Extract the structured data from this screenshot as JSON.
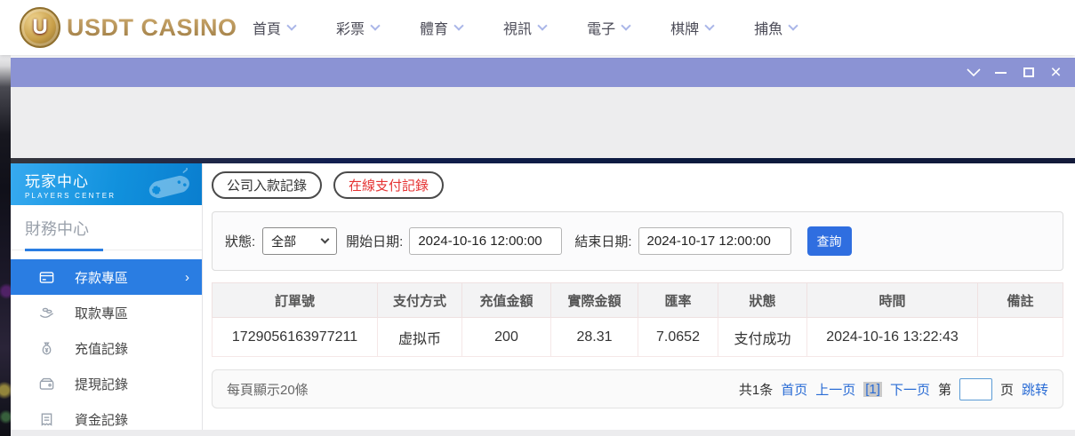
{
  "header": {
    "logo_text": "USDT CASINO",
    "logo_letter": "U",
    "nav": [
      {
        "label": "首頁"
      },
      {
        "label": "彩票"
      },
      {
        "label": "體育"
      },
      {
        "label": "視訊"
      },
      {
        "label": "電子"
      },
      {
        "label": "棋牌"
      },
      {
        "label": "捕魚"
      }
    ]
  },
  "sidebar": {
    "title": "玩家中心",
    "subtitle": "PLAYERS CENTER",
    "section_label": "財務中心",
    "items": [
      {
        "label": "存款專區",
        "active": true,
        "arrow": "›"
      },
      {
        "label": "取款專區",
        "active": false
      },
      {
        "label": "充值記錄",
        "active": false
      },
      {
        "label": "提現記錄",
        "active": false
      },
      {
        "label": "資金記錄",
        "active": false
      }
    ]
  },
  "main": {
    "tabs": [
      {
        "label": "公司入款記錄",
        "active": false
      },
      {
        "label": "在線支付記錄",
        "active": true
      }
    ],
    "filters": {
      "status_label": "狀態:",
      "status_value": "全部",
      "start_label": "開始日期:",
      "start_value": "2024-10-16 12:00:00",
      "end_label": "結束日期:",
      "end_value": "2024-10-17 12:00:00",
      "search_button": "查詢"
    },
    "table": {
      "columns": [
        "訂單號",
        "支付方式",
        "充值金額",
        "實際金額",
        "匯率",
        "狀態",
        "時間",
        "備註"
      ],
      "rows": [
        [
          "1729056163977211",
          "虚拟币",
          "200",
          "28.31",
          "7.0652",
          "支付成功",
          "2024-10-16 13:22:43",
          ""
        ]
      ]
    },
    "pagination": {
      "page_size_text": "每頁顯示20條",
      "total_text": "共1条",
      "first": "首页",
      "prev": "上一页",
      "current": "[1]",
      "next": "下一页",
      "jump_prefix": "第",
      "jump_suffix": "页",
      "jump_action": "跳转"
    }
  },
  "colors": {
    "titlebar_purple": "#8b93d4",
    "sidebar_header_blue": "#1191dd",
    "active_item_blue": "#2a7de2",
    "search_button_blue": "#2f6ee0",
    "link_blue": "#2a6cd5",
    "active_tab_red": "#e53333",
    "logo_gold": "#b5905a"
  }
}
